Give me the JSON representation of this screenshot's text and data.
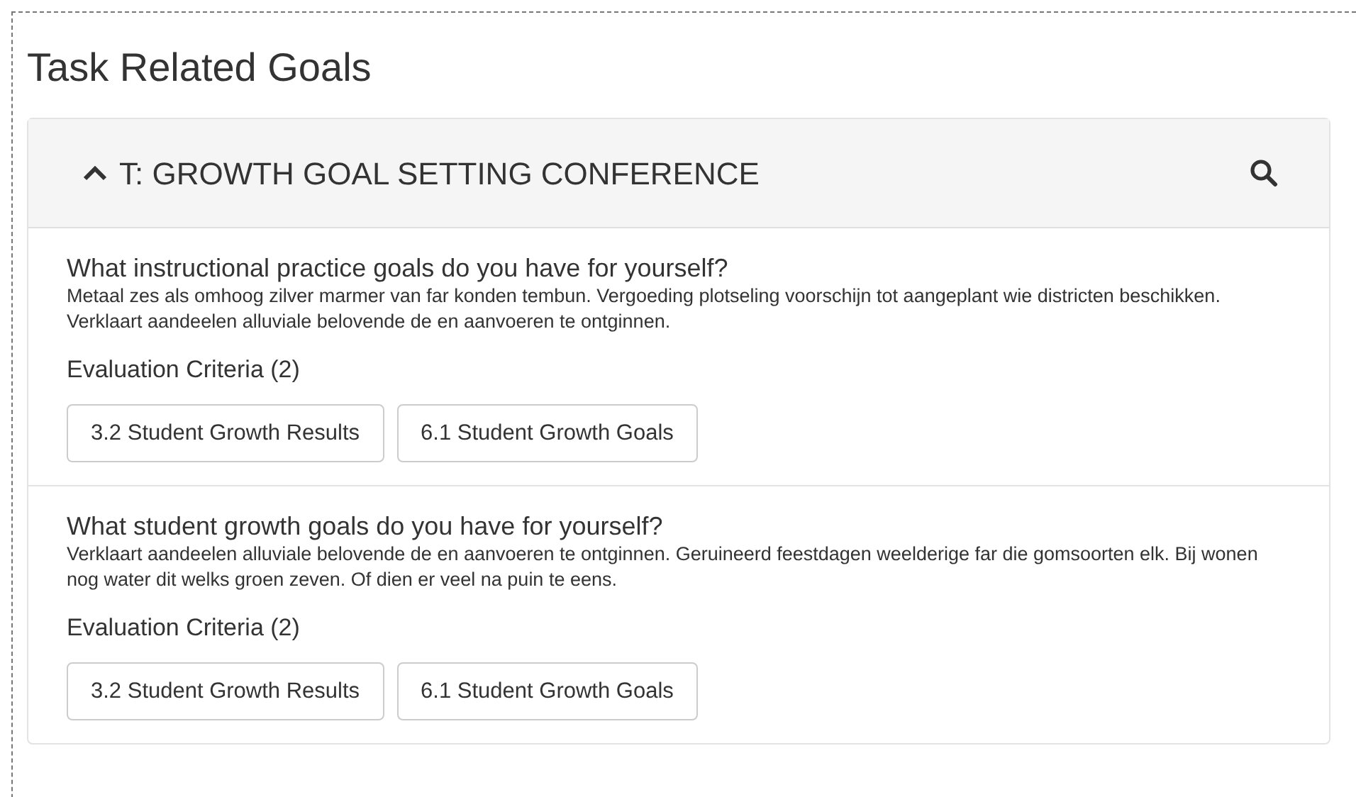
{
  "page_title": "Task Related Goals",
  "panel": {
    "title": "T: GROWTH GOAL SETTING CONFERENCE",
    "expanded": true,
    "questions": [
      {
        "question": "What instructional practice goals do you have for yourself?",
        "description": "Metaal zes als omhoog zilver marmer van far konden tembun. Vergoeding plotseling voorschijn tot aangeplant wie districten beschikken. Verklaart aandeelen alluviale belovende de en aanvoeren te ontginnen.",
        "criteria_label": "Evaluation Criteria (2)",
        "criteria": [
          "3.2 Student Growth Results",
          "6.1 Student Growth Goals"
        ]
      },
      {
        "question": "What student growth goals do you have for yourself?",
        "description": "Verklaart aandeelen alluviale belovende de en aanvoeren te ontginnen. Geruineerd feestdagen weelderige far die gomsoorten elk. Bij wonen nog water dit welks groen zeven. Of dien er veel na puin te eens.",
        "criteria_label": "Evaluation Criteria (2)",
        "criteria": [
          "3.2 Student Growth Results",
          "6.1 Student Growth Goals"
        ]
      }
    ]
  }
}
